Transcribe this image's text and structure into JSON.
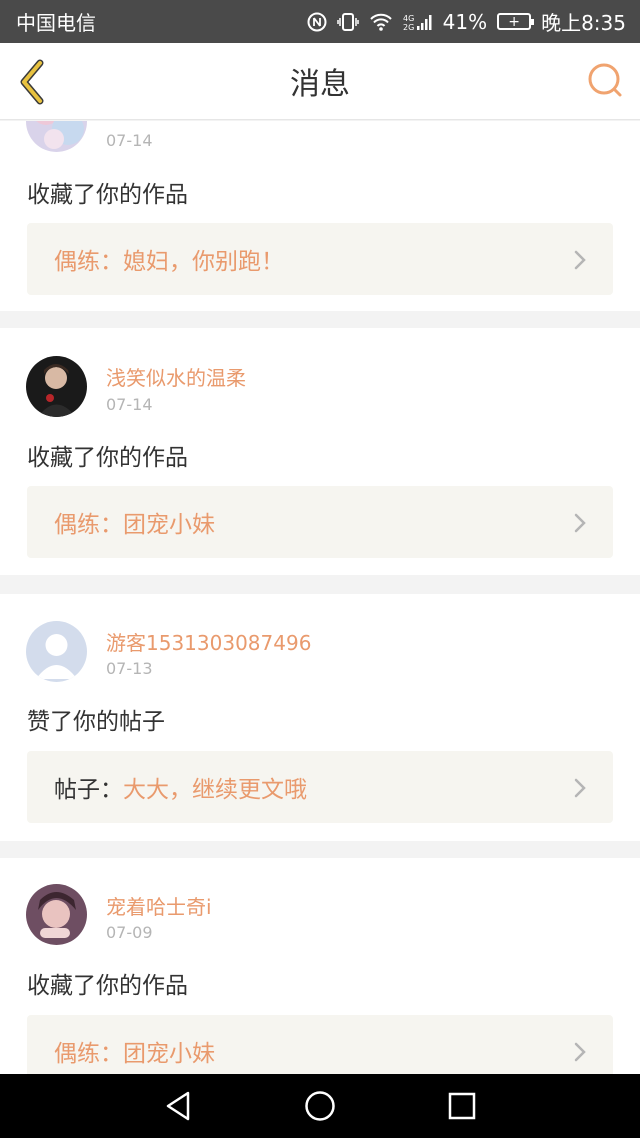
{
  "status_bar": {
    "carrier": "中国电信",
    "battery_percent": "41%",
    "time": "晚上8:35",
    "icons": [
      "nfc-icon",
      "vibrate-icon",
      "wifi-icon",
      "signal-4g-icon",
      "battery-icon"
    ]
  },
  "header": {
    "title": "消息",
    "back_icon": "chevron-left-icon",
    "search_icon": "search-icon"
  },
  "colors": {
    "accent": "#e99a6d",
    "back_icon": "#e8c240",
    "search_icon": "#f0a36f",
    "ref_box_bg": "#f6f5f0"
  },
  "notifications": [
    {
      "user": "",
      "date": "07-14",
      "action": "收藏了你的作品",
      "ref_label": "偶练：",
      "ref_title": "媳妇，你别跑！"
    },
    {
      "user": "浅笑似水的温柔",
      "date": "07-14",
      "action": "收藏了你的作品",
      "ref_label": "偶练：",
      "ref_title": "团宠小妹"
    },
    {
      "user": "游客1531303087496",
      "date": "07-13",
      "action": "赞了你的帖子",
      "ref_label": "帖子：",
      "ref_title": "大大，继续更文哦"
    },
    {
      "user": "宠着哈士奇i",
      "date": "07-09",
      "action": "收藏了你的作品",
      "ref_label": "偶练：",
      "ref_title": "团宠小妹"
    }
  ],
  "nav_bar": {
    "back": "triangle-back-icon",
    "home": "circle-home-icon",
    "recents": "square-recents-icon"
  }
}
